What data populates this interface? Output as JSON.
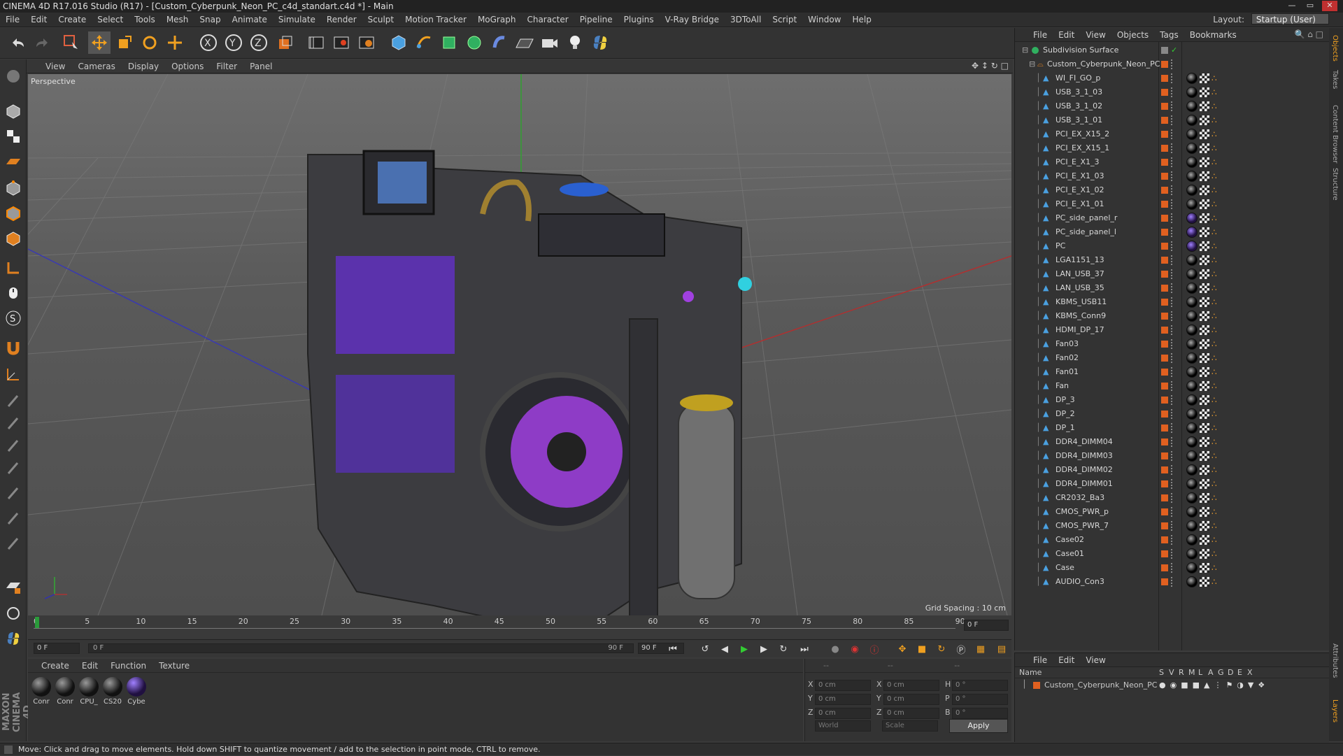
{
  "window": {
    "title": "CINEMA 4D R17.016 Studio (R17) - [Custom_Cyberpunk_Neon_PC_c4d_standart.c4d *] - Main"
  },
  "menu": [
    "File",
    "Edit",
    "Create",
    "Select",
    "Tools",
    "Mesh",
    "Snap",
    "Animate",
    "Simulate",
    "Render",
    "Sculpt",
    "Motion Tracker",
    "MoGraph",
    "Character",
    "Pipeline",
    "Plugins",
    "V-Ray Bridge",
    "3DToAll",
    "Script",
    "Window",
    "Help"
  ],
  "layout": {
    "label": "Layout:",
    "value": "Startup (User)"
  },
  "viewport": {
    "menu": [
      "View",
      "Cameras",
      "Display",
      "Options",
      "Filter",
      "Panel"
    ],
    "label": "Perspective",
    "grid_spacing": "Grid Spacing : 10 cm"
  },
  "timeline": {
    "ticks": [
      "0",
      "5",
      "10",
      "15",
      "20",
      "25",
      "30",
      "35",
      "40",
      "45",
      "50",
      "55",
      "60",
      "65",
      "70",
      "75",
      "80",
      "85",
      "90"
    ],
    "end_frame_field": "0 F",
    "start_field": "0 F",
    "range_start": "0 F",
    "range_end": "90 F",
    "end_field": "90 F"
  },
  "material_manager": {
    "menu": [
      "Create",
      "Edit",
      "Function",
      "Texture"
    ],
    "materials": [
      "Conr",
      "Conr",
      "CPU_",
      "CS20",
      "Cybe"
    ]
  },
  "coordinates": {
    "rows": [
      {
        "axis": "X",
        "pos": "0 cm",
        "axis2": "X",
        "size": "0 cm",
        "axis3": "H",
        "rot": "0 °"
      },
      {
        "axis": "Y",
        "pos": "0 cm",
        "axis2": "Y",
        "size": "0 cm",
        "axis3": "P",
        "rot": "0 °"
      },
      {
        "axis": "Z",
        "pos": "0 cm",
        "axis2": "Z",
        "size": "0 cm",
        "axis3": "B",
        "rot": "0 °"
      }
    ],
    "mode": "World",
    "scale": "Scale",
    "apply": "Apply"
  },
  "object_manager": {
    "menu": [
      "File",
      "Edit",
      "View",
      "Objects",
      "Tags",
      "Bookmarks"
    ],
    "root": "Subdivision Surface",
    "group": "Custom_Cyberpunk_Neon_PC",
    "objects": [
      "WI_FI_GO_p",
      "USB_3_1_03",
      "USB_3_1_02",
      "USB_3_1_01",
      "PCI_EX_X15_2",
      "PCI_EX_X15_1",
      "PCI_E_X1_3",
      "PCI_E_X1_03",
      "PCI_E_X1_02",
      "PCI_E_X1_01",
      "PC_side_panel_r",
      "PC_side_panel_l",
      "PC",
      "LGA1151_13",
      "LAN_USB_37",
      "LAN_USB_35",
      "KBMS_USB11",
      "KBMS_Conn9",
      "HDMI_DP_17",
      "Fan03",
      "Fan02",
      "Fan01",
      "Fan",
      "DP_3",
      "DP_2",
      "DP_1",
      "DDR4_DIMM04",
      "DDR4_DIMM03",
      "DDR4_DIMM02",
      "DDR4_DIMM01",
      "CR2032_Ba3",
      "CMOS_PWR_p",
      "CMOS_PWR_7",
      "Case02",
      "Case01",
      "Case",
      "AUDIO_Con3"
    ]
  },
  "layer_manager": {
    "menu": [
      "File",
      "Edit",
      "View"
    ],
    "header": "Name",
    "cols": [
      "S",
      "V",
      "R",
      "M",
      "L",
      "A",
      "G",
      "D",
      "E",
      "X"
    ],
    "item": "Custom_Cyberpunk_Neon_PC"
  },
  "right_tabs": [
    "Objects",
    "Takes",
    "Content Browser",
    "Structure",
    "Attributes",
    "Layers"
  ],
  "status": "Move: Click and drag to move elements. Hold down SHIFT to quantize movement / add to the selection in point mode, CTRL to remove.",
  "brand": "MAXON CINEMA 4D"
}
